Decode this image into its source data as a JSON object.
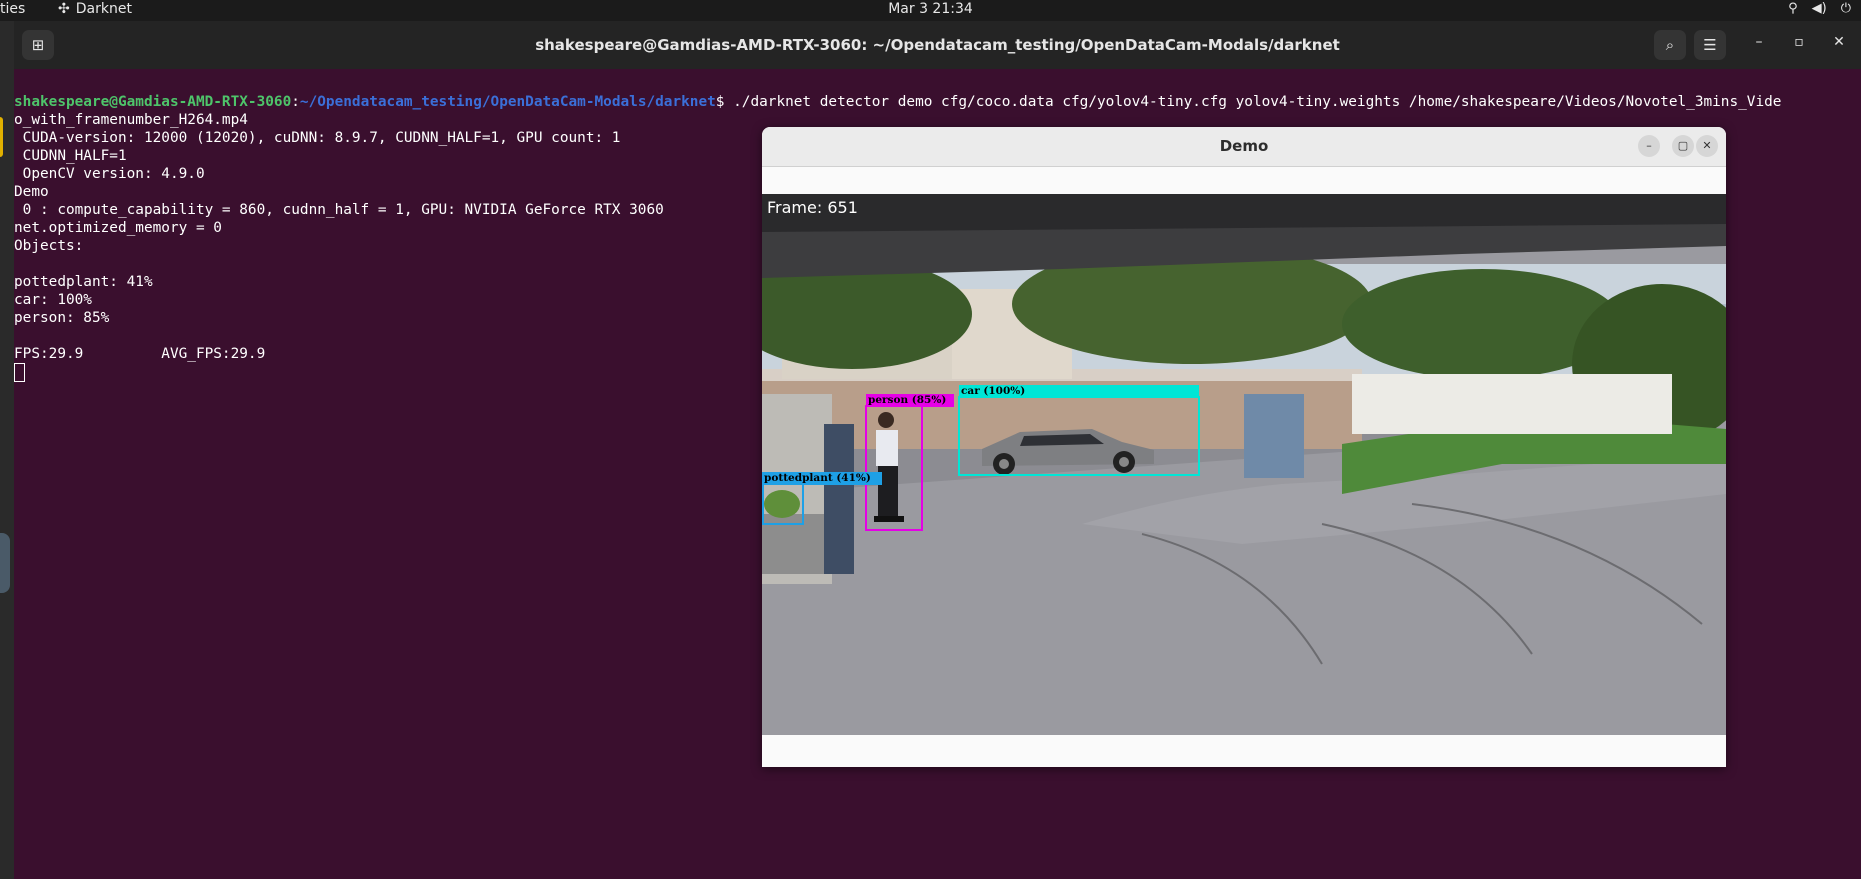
{
  "topbar": {
    "activities": "ties",
    "app_name": "Darknet",
    "clock": "Mar 3  21:34"
  },
  "terminal": {
    "title": "shakespeare@Gamdias-AMD-RTX-3060: ~/Opendatacam_testing/OpenDataCam-Modals/darknet",
    "prompt_user": "shakespeare@Gamdias-AMD-RTX-3060",
    "prompt_sep": ":",
    "prompt_path": "~/Opendatacam_testing/OpenDataCam-Modals/darknet",
    "prompt_symbol": "$ ",
    "command": "./darknet detector demo cfg/coco.data cfg/yolov4-tiny.cfg yolov4-tiny.weights /home/shakespeare/Videos/Novotel_3mins_Vide",
    "lines": [
      "o_with_framenumber_H264.mp4",
      " CUDA-version: 12000 (12020), cuDNN: 8.9.7, CUDNN_HALF=1, GPU count: 1",
      " CUDNN_HALF=1",
      " OpenCV version: 4.9.0",
      "Demo",
      " 0 : compute_capability = 860, cudnn_half = 1, GPU: NVIDIA GeForce RTX 3060",
      "net.optimized_memory = 0",
      "Objects:",
      "",
      "pottedplant: 41%",
      "car: 100%",
      "person: 85%",
      "",
      "FPS:29.9         AVG_FPS:29.9"
    ]
  },
  "demo": {
    "title": "Demo",
    "frame_label": "Frame: 651",
    "detections": [
      {
        "label": "person (85%)",
        "color": "#e600e6"
      },
      {
        "label": "car (100%)",
        "color": "#00e6d6"
      },
      {
        "label": "pottedplant (41%)",
        "color": "#1ea0e6"
      }
    ]
  }
}
